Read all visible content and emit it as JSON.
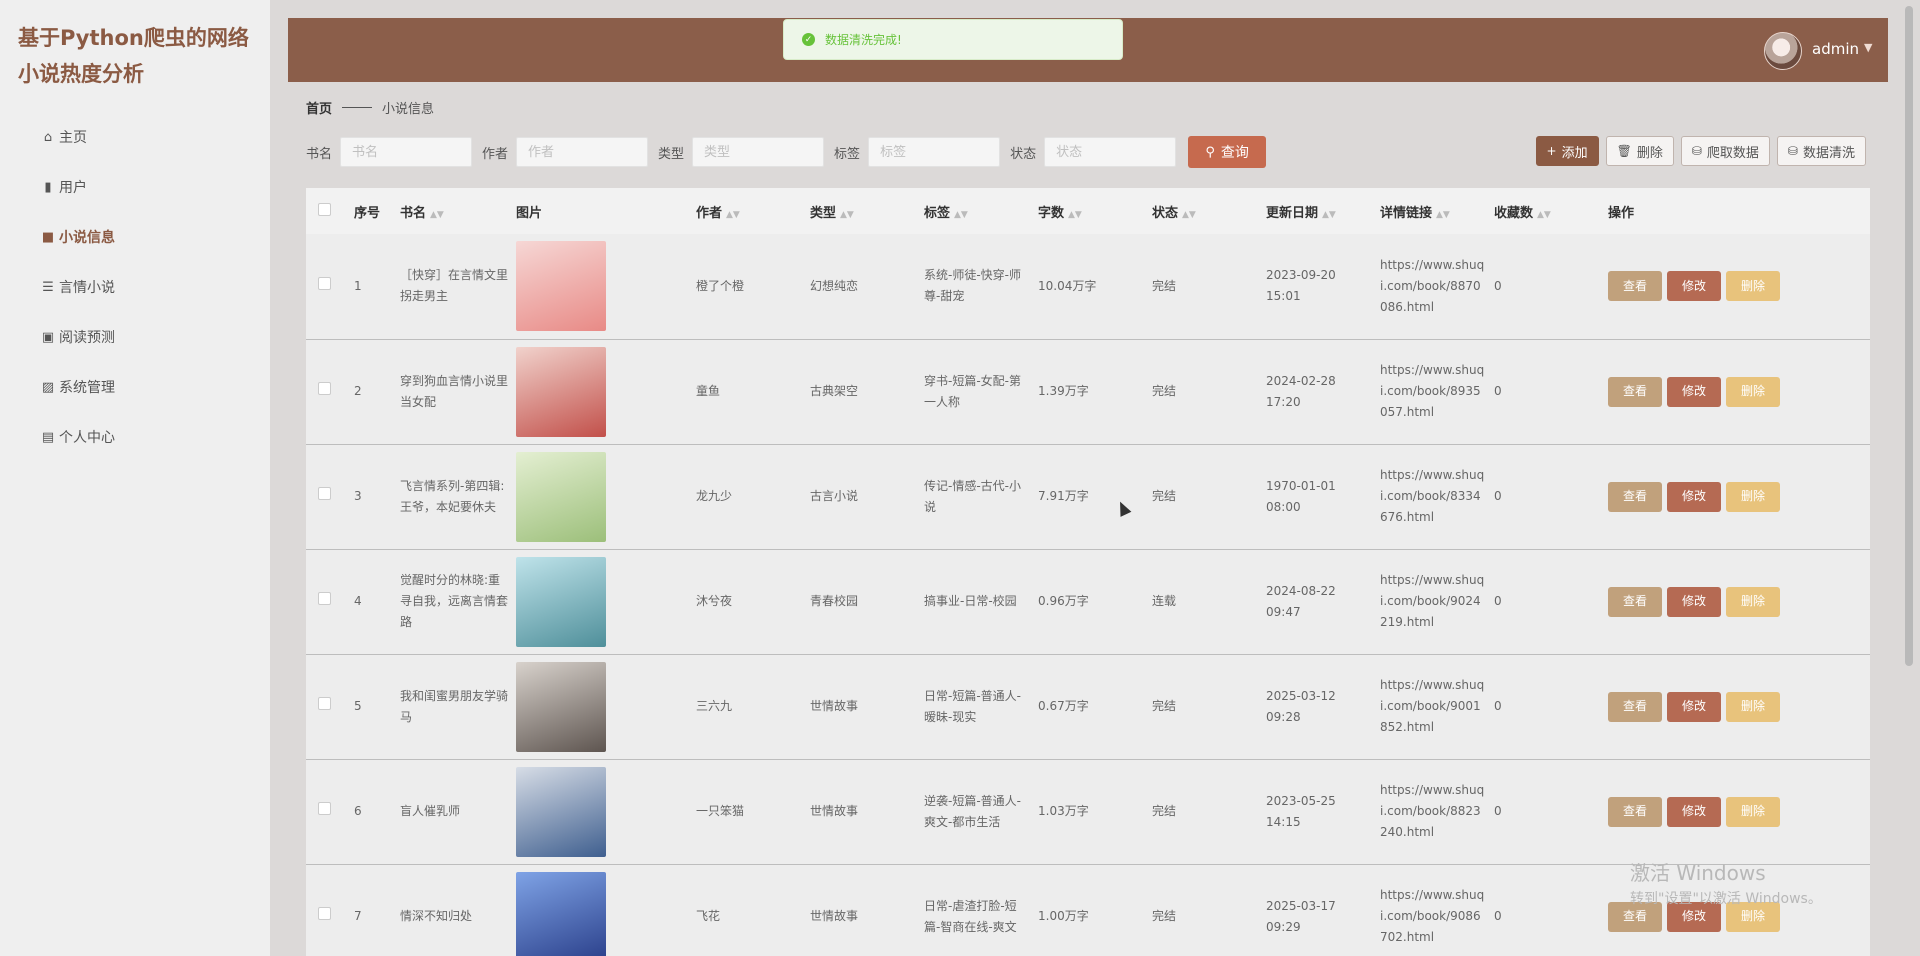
{
  "app": {
    "title": "基于Python爬虫的网络小说热度分析"
  },
  "sidebar": {
    "items": [
      {
        "label": "主页",
        "icon": "home-icon",
        "glyph": "⌂",
        "active": false
      },
      {
        "label": "用户",
        "icon": "bar-chart-icon",
        "glyph": "▮",
        "active": false
      },
      {
        "label": "小说信息",
        "icon": "briefcase-icon",
        "glyph": "■",
        "active": true
      },
      {
        "label": "言情小说",
        "icon": "list-icon",
        "glyph": "☰",
        "active": false
      },
      {
        "label": "阅读预测",
        "icon": "briefcase-icon",
        "glyph": "▣",
        "active": false
      },
      {
        "label": "系统管理",
        "icon": "chart-icon",
        "glyph": "▨",
        "active": false
      },
      {
        "label": "个人中心",
        "icon": "calendar-icon",
        "glyph": "▤",
        "active": false
      }
    ]
  },
  "header": {
    "username": "admin"
  },
  "toast": {
    "message": "数据清洗完成!"
  },
  "breadcrumb": {
    "home": "首页",
    "current": "小说信息"
  },
  "search": {
    "fields": [
      {
        "label": "书名",
        "placeholder": "书名"
      },
      {
        "label": "作者",
        "placeholder": "作者"
      },
      {
        "label": "类型",
        "placeholder": "类型"
      },
      {
        "label": "标签",
        "placeholder": "标签"
      },
      {
        "label": "状态",
        "placeholder": "状态"
      }
    ],
    "query_label": "查询"
  },
  "actions": {
    "add": "添加",
    "delete": "删除",
    "crawl": "爬取数据",
    "clean": "数据清洗"
  },
  "table": {
    "headers": {
      "index": "序号",
      "name": "书名",
      "image": "图片",
      "author": "作者",
      "type": "类型",
      "tags": "标签",
      "words": "字数",
      "status": "状态",
      "updated": "更新日期",
      "link": "详情链接",
      "favorites": "收藏数",
      "ops": "操作"
    },
    "op_labels": {
      "view": "查看",
      "edit": "修改",
      "delete": "删除"
    },
    "rows": [
      {
        "index": "1",
        "name": "［快穿］在言情文里拐走男主",
        "author": "橙了个橙",
        "type": "幻想纯恋",
        "tags": "系统-师徒-快穿-师尊-甜宠",
        "words": "10.04万字",
        "status": "完结",
        "updated": "2023-09-20 15:01",
        "link": "https://www.shuqi.com/book/8870086.html",
        "favorites": "0",
        "cover_a": "#f6d7d5",
        "cover_b": "#e88a86"
      },
      {
        "index": "2",
        "name": "穿到狗血言情小说里当女配",
        "author": "童鱼",
        "type": "古典架空",
        "tags": "穿书-短篇-女配-第一人称",
        "words": "1.39万字",
        "status": "完结",
        "updated": "2024-02-28 17:20",
        "link": "https://www.shuqi.com/book/8935057.html",
        "favorites": "0",
        "cover_a": "#f1d2cc",
        "cover_b": "#c2504a"
      },
      {
        "index": "3",
        "name": "飞言情系列-第四辑:王爷，本妃要休夫",
        "author": "龙九少",
        "type": "古言小说",
        "tags": "传记-情感-古代-小说",
        "words": "7.91万字",
        "status": "完结",
        "updated": "1970-01-01 08:00",
        "link": "https://www.shuqi.com/book/8334676.html",
        "favorites": "0",
        "cover_a": "#e4efd2",
        "cover_b": "#9cbf7a"
      },
      {
        "index": "4",
        "name": "觉醒时分的林晓:重寻自我，远离言情套路",
        "author": "沐兮夜",
        "type": "青春校园",
        "tags": "搞事业-日常-校园",
        "words": "0.96万字",
        "status": "连载",
        "updated": "2024-08-22 09:47",
        "link": "https://www.shuqi.com/book/9024219.html",
        "favorites": "0",
        "cover_a": "#bfe3ea",
        "cover_b": "#4f8f9a"
      },
      {
        "index": "5",
        "name": "我和闺蜜男朋友学骑马",
        "author": "三六九",
        "type": "世情故事",
        "tags": "日常-短篇-普通人-暧昧-现实",
        "words": "0.67万字",
        "status": "完结",
        "updated": "2025-03-12 09:28",
        "link": "https://www.shuqi.com/book/9001852.html",
        "favorites": "0",
        "cover_a": "#d8d2cc",
        "cover_b": "#5e5550"
      },
      {
        "index": "6",
        "name": "盲人催乳师",
        "author": "一只笨猫",
        "type": "世情故事",
        "tags": "逆袭-短篇-普通人-爽文-都市生活",
        "words": "1.03万字",
        "status": "完结",
        "updated": "2023-05-25 14:15",
        "link": "https://www.shuqi.com/book/8823240.html",
        "favorites": "0",
        "cover_a": "#d7dde6",
        "cover_b": "#3f5f8f"
      },
      {
        "index": "7",
        "name": "情深不知归处",
        "author": "飞花",
        "type": "世情故事",
        "tags": "日常-虐渣打脸-短篇-智商在线-爽文",
        "words": "1.00万字",
        "status": "完结",
        "updated": "2025-03-17 09:29",
        "link": "https://www.shuqi.com/book/9086702.html",
        "favorites": "0",
        "cover_a": "#7fa3e6",
        "cover_b": "#2a3f8a"
      }
    ]
  },
  "watermark": {
    "line1": "激活 Windows",
    "line2": "转到\"设置\"以激活 Windows。"
  }
}
